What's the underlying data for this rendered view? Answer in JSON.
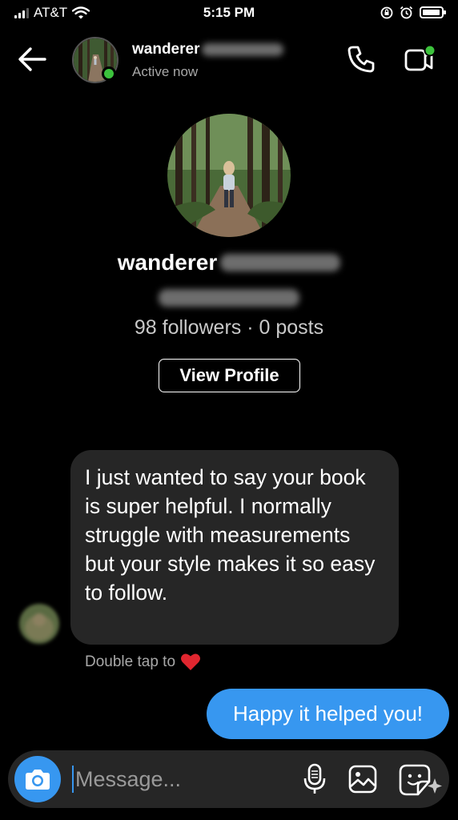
{
  "status_bar": {
    "carrier": "AT&T",
    "time": "5:15 PM"
  },
  "header": {
    "username": "wanderer",
    "activity": "Active now"
  },
  "profile": {
    "name": "wanderer",
    "stats": "98 followers · 0 posts",
    "view_profile_label": "View Profile"
  },
  "messages": {
    "incoming": "I just wanted to say your book is super helpful. I normally struggle with measurements but your style makes it so easy to follow.",
    "double_tap_hint": "Double tap to",
    "outgoing": "Happy it helped you!"
  },
  "composer": {
    "placeholder": "Message..."
  },
  "colors": {
    "accent": "#3797f0",
    "online": "#3cc23c",
    "heart": "#e0262f",
    "bubble_incoming": "#262626"
  },
  "icons": {
    "back": "arrow-left-icon",
    "call": "phone-icon",
    "video": "video-camera-icon",
    "camera": "camera-icon",
    "mic": "microphone-icon",
    "gallery": "image-icon",
    "sticker": "sticker-icon",
    "heart": "heart-icon"
  }
}
